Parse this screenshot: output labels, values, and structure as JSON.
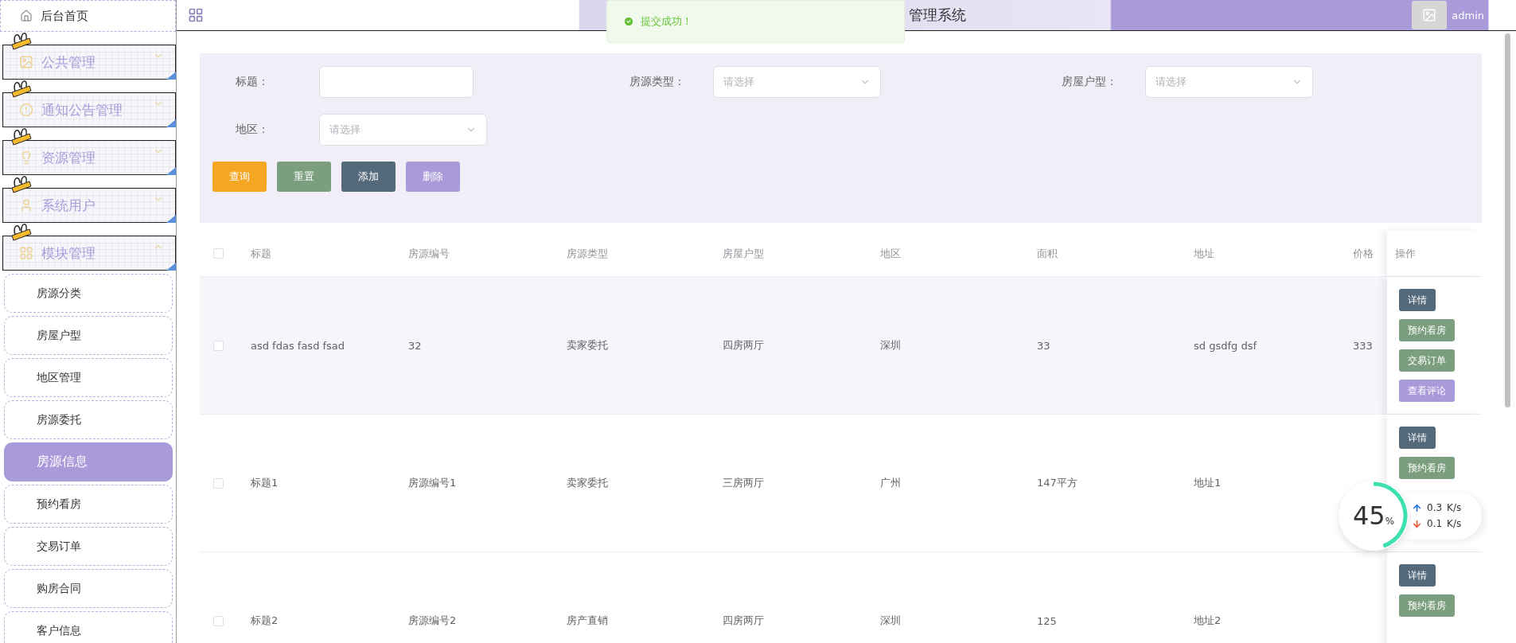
{
  "sidebar": {
    "home": "后台首页",
    "groups": [
      {
        "label": "公共管理",
        "expanded": false
      },
      {
        "label": "通知公告管理",
        "expanded": false
      },
      {
        "label": "资源管理",
        "expanded": false
      },
      {
        "label": "系统用户",
        "expanded": false
      },
      {
        "label": "模块管理",
        "expanded": true
      }
    ],
    "items": [
      {
        "label": "房源分类",
        "selected": false
      },
      {
        "label": "房屋户型",
        "selected": false
      },
      {
        "label": "地区管理",
        "selected": false
      },
      {
        "label": "房源委托",
        "selected": false
      },
      {
        "label": "房源信息",
        "selected": true
      },
      {
        "label": "预约看房",
        "selected": false
      },
      {
        "label": "交易订单",
        "selected": false
      },
      {
        "label": "购房合同",
        "selected": false
      },
      {
        "label": "客户信息",
        "selected": false
      }
    ]
  },
  "header": {
    "title": "管理系统",
    "user": "admin"
  },
  "toast": {
    "message": "提交成功！"
  },
  "filters": [
    {
      "label": "标题：",
      "kind": "input"
    },
    {
      "label": "房源类型：",
      "kind": "select",
      "placeholder": "请选择"
    },
    {
      "label": "房屋户型：",
      "kind": "select",
      "placeholder": "请选择"
    },
    {
      "label": "地区：",
      "kind": "select",
      "placeholder": "请选择"
    }
  ],
  "buttons": [
    {
      "label": "查询",
      "color": "#f5a623"
    },
    {
      "label": "重置",
      "color": "#7a9e7e"
    },
    {
      "label": "添加",
      "color": "#546a7b"
    },
    {
      "label": "删除",
      "color": "#a99ada"
    }
  ],
  "table": {
    "select_all": {
      "checked": false
    },
    "columns": [
      "标题",
      "房源编号",
      "房源类型",
      "房屋户型",
      "地区",
      "面积",
      "地址",
      "价格",
      "操作"
    ],
    "rows": [
      {
        "checked": false,
        "cells": [
          "asd fdas fasd fsad",
          "32",
          "卖家委托",
          "四房两厅",
          "深圳",
          "33",
          "sd gsdfg dsf",
          "333"
        ],
        "actions": [
          {
            "label": "详情",
            "color": "#546a7b"
          },
          {
            "label": "预约看房",
            "color": "#7a9e7e"
          },
          {
            "label": "交易订单",
            "color": "#7a9e7e"
          },
          {
            "label": "查看评论",
            "color": "#a99ada"
          }
        ]
      },
      {
        "checked": false,
        "cells": [
          "标题1",
          "房源编号1",
          "卖家委托",
          "三房两厅",
          "广州",
          "147平方",
          "地址1"
        ],
        "actions": [
          {
            "label": "详情",
            "color": "#546a7b"
          },
          {
            "label": "预约看房",
            "color": "#7a9e7e"
          }
        ]
      },
      {
        "checked": false,
        "cells": [
          "标题2",
          "房源编号2",
          "房产直销",
          "四房两厅",
          "深圳",
          "125",
          "地址2"
        ],
        "actions": [
          {
            "label": "详情",
            "color": "#546a7b"
          },
          {
            "label": "预约看房",
            "color": "#7a9e7e"
          }
        ]
      }
    ]
  },
  "speed_widget": {
    "percent": "45",
    "unit": "%",
    "level": 0.45,
    "upload": "0.3",
    "upload_unit": "K/s",
    "download": "0.1",
    "download_unit": "K/s"
  }
}
